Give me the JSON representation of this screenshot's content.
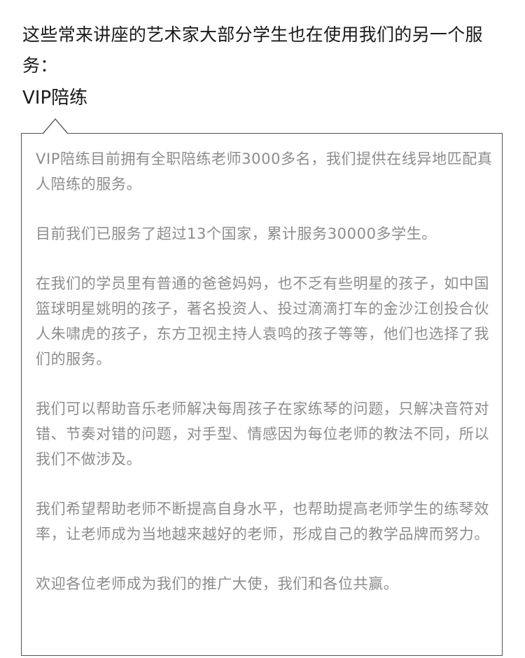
{
  "intro": {
    "text": "这些常来讲座的艺术家大部分学生也在使用我们的另一个服务："
  },
  "heading": {
    "text": "VIP陪练"
  },
  "content": {
    "paragraphs": [
      "VIP陪练目前拥有全职陪练老师3000多名，我们提供在线异地匹配真人陪练的服务。",
      "目前我们已服务了超过13个国家，累计服务30000多学生。",
      "在我们的学员里有普通的爸爸妈妈，也不乏有些明星的孩子，如中国篮球明星姚明的孩子，著名投资人、投过滴滴打车的金沙江创投合伙人朱啸虎的孩子，东方卫视主持人袁鸣的孩子等等，他们也选择了我们的服务。",
      "我们可以帮助音乐老师解决每周孩子在家练琴的问题，只解决音符对错、节奏对错的问题，对手型、情感因为每位老师的教法不同，所以我们不做涉及。",
      "我们希望帮助老师不断提高自身水平，也帮助提高老师学生的练琴效率，让老师成为当地越来越好的老师，形成自己的教学品牌而努力。",
      "欢迎各位老师成为我们的推广大使，我们和各位共赢。"
    ]
  }
}
